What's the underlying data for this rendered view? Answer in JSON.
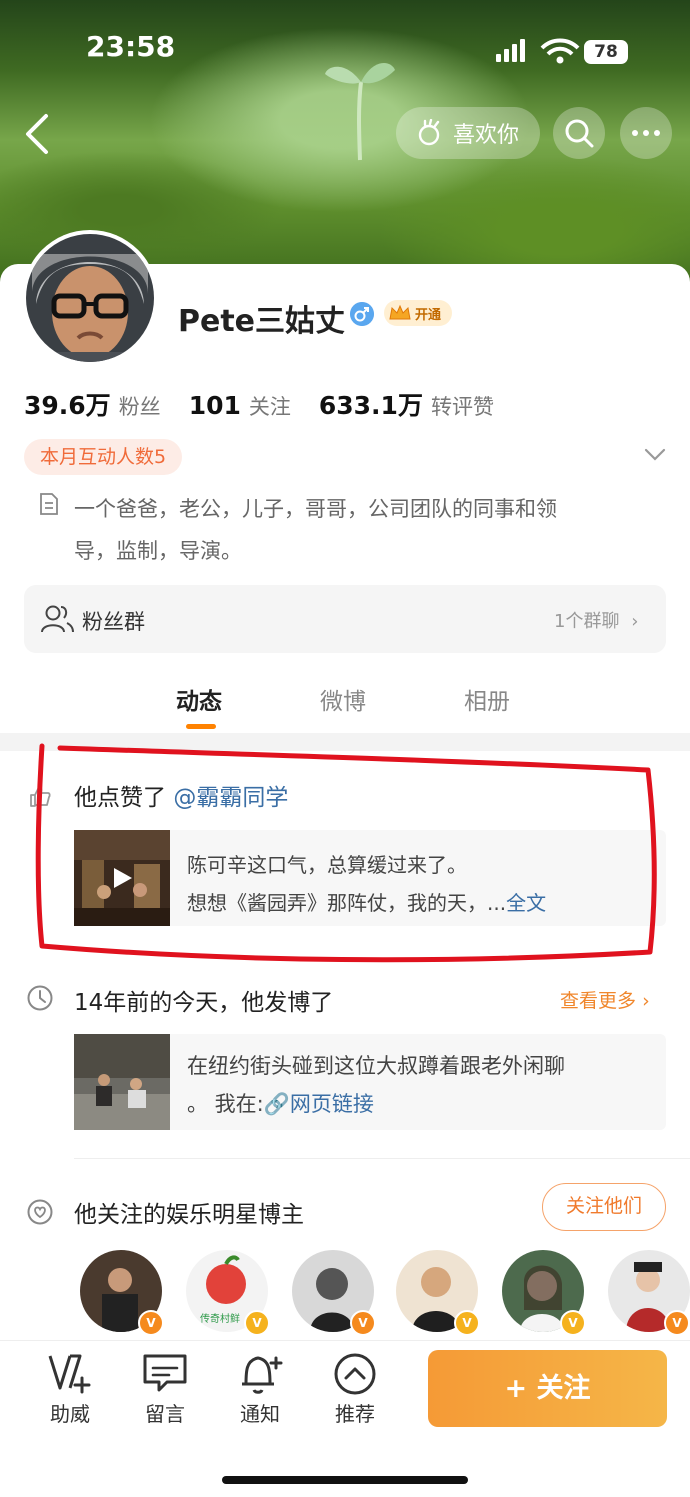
{
  "status_bar": {
    "time": "23:58",
    "battery": "78"
  },
  "header": {
    "like_label": "喜欢你"
  },
  "profile": {
    "name": "Pete三姑丈",
    "vip_label": "开通",
    "stats": [
      {
        "value": "39.6万",
        "label": "粉丝"
      },
      {
        "value": "101",
        "label": "关注"
      },
      {
        "value": "633.1万",
        "label": "转评赞"
      }
    ],
    "interaction_badge": "本月互动人数5",
    "bio_line1": "一个爸爸，老公，儿子，哥哥，公司团队的同事和领",
    "bio_line2": "导，监制，导演。"
  },
  "fan_group": {
    "label": "粉丝群",
    "right_text": "1个群聊"
  },
  "tabs": [
    {
      "label": "动态",
      "active": true
    },
    {
      "label": "微博",
      "active": false
    },
    {
      "label": "相册",
      "active": false
    }
  ],
  "feed": {
    "liked": {
      "prefix": "他点赞了",
      "mention": "@霸霸同学",
      "line1": "陈可辛这口气，总算缓过来了。",
      "line2": "想想《酱园弄》那阵仗，我的天，...",
      "full_text": "全文"
    },
    "memory": {
      "title": "14年前的今天，他发博了",
      "more": "查看更多",
      "line1": "在纽约街头碰到这位大叔蹲着跟老外闲聊",
      "line2_prefix": "。 我在:",
      "link": "网页链接"
    },
    "recommend": {
      "title": "他关注的娱乐明星博主",
      "follow_all": "关注他们",
      "sticker_text": "传奇村鲜"
    }
  },
  "bottom_nav": {
    "items": [
      {
        "label": "助威"
      },
      {
        "label": "留言"
      },
      {
        "label": "通知"
      },
      {
        "label": "推荐"
      }
    ],
    "follow_button": "+ 关注"
  },
  "colors": {
    "accent": "#ff8200",
    "link": "#3a6ea5",
    "follow": "#f5a63f",
    "annotation": "#e0121e"
  }
}
